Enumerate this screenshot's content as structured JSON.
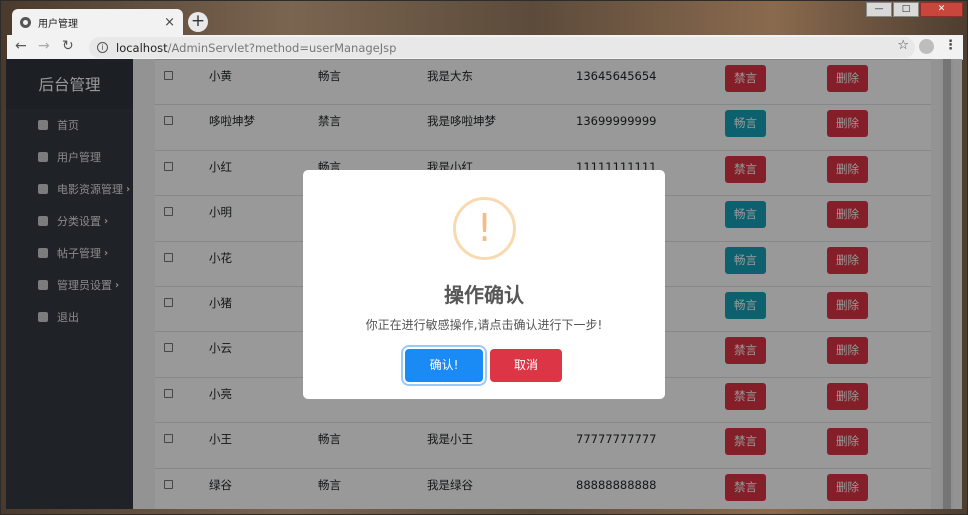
{
  "browser": {
    "tab_title": "用户管理",
    "tab_close": "×",
    "new_tab": "+",
    "url_host": "localhost",
    "url_path": "/AdminServlet?method=userManageJsp",
    "info_icon": "i",
    "star": "☆",
    "back": "←",
    "forward": "→",
    "reload": "↻",
    "menu": "⋮",
    "win_min": "—",
    "win_max": "□",
    "win_close": "✕"
  },
  "sidebar": {
    "title": "后台管理",
    "items": [
      {
        "label": "首页",
        "icon": "dashboard-icon",
        "chevron": ""
      },
      {
        "label": "用户管理",
        "icon": "user-icon",
        "chevron": ""
      },
      {
        "label": "电影资源管理",
        "icon": "folder-icon",
        "chevron": "›"
      },
      {
        "label": "分类设置",
        "icon": "cube-icon",
        "chevron": "›"
      },
      {
        "label": "帖子管理",
        "icon": "folder-icon",
        "chevron": "›"
      },
      {
        "label": "管理员设置",
        "icon": "cube-icon",
        "chevron": "›"
      },
      {
        "label": "退出",
        "icon": "sign-out-icon",
        "chevron": ""
      }
    ]
  },
  "table": {
    "rows": [
      {
        "name": "小黄",
        "status": "畅言",
        "sign": "我是大东",
        "phone": "13645645654",
        "toggle": "禁言",
        "toggle_type": "danger",
        "delete": "删除"
      },
      {
        "name": "哆啦坤梦",
        "status": "禁言",
        "sign": "我是哆啦坤梦",
        "phone": "13699999999",
        "toggle": "畅言",
        "toggle_type": "info",
        "delete": "删除"
      },
      {
        "name": "小红",
        "status": "畅言",
        "sign": "我是小红",
        "phone": "11111111111",
        "toggle": "禁言",
        "toggle_type": "danger",
        "delete": "删除"
      },
      {
        "name": "小明",
        "status": "",
        "sign": "",
        "phone": "",
        "toggle": "畅言",
        "toggle_type": "info",
        "delete": "删除"
      },
      {
        "name": "小花",
        "status": "",
        "sign": "",
        "phone": "",
        "toggle": "畅言",
        "toggle_type": "info",
        "delete": "删除"
      },
      {
        "name": "小猪",
        "status": "",
        "sign": "",
        "phone": "",
        "toggle": "畅言",
        "toggle_type": "info",
        "delete": "删除"
      },
      {
        "name": "小云",
        "status": "",
        "sign": "",
        "phone": "",
        "toggle": "禁言",
        "toggle_type": "danger",
        "delete": "删除"
      },
      {
        "name": "小亮",
        "status": "",
        "sign": "",
        "phone": "",
        "toggle": "禁言",
        "toggle_type": "danger",
        "delete": "删除"
      },
      {
        "name": "小王",
        "status": "畅言",
        "sign": "我是小王",
        "phone": "77777777777",
        "toggle": "禁言",
        "toggle_type": "danger",
        "delete": "删除"
      },
      {
        "name": "绿谷",
        "status": "畅言",
        "sign": "我是绿谷",
        "phone": "88888888888",
        "toggle": "禁言",
        "toggle_type": "danger",
        "delete": "删除"
      }
    ]
  },
  "modal": {
    "icon": "!",
    "title": "操作确认",
    "text": "你正在进行敏感操作,请点击确认进行下一步!",
    "confirm": "确认!",
    "cancel": "取消"
  }
}
